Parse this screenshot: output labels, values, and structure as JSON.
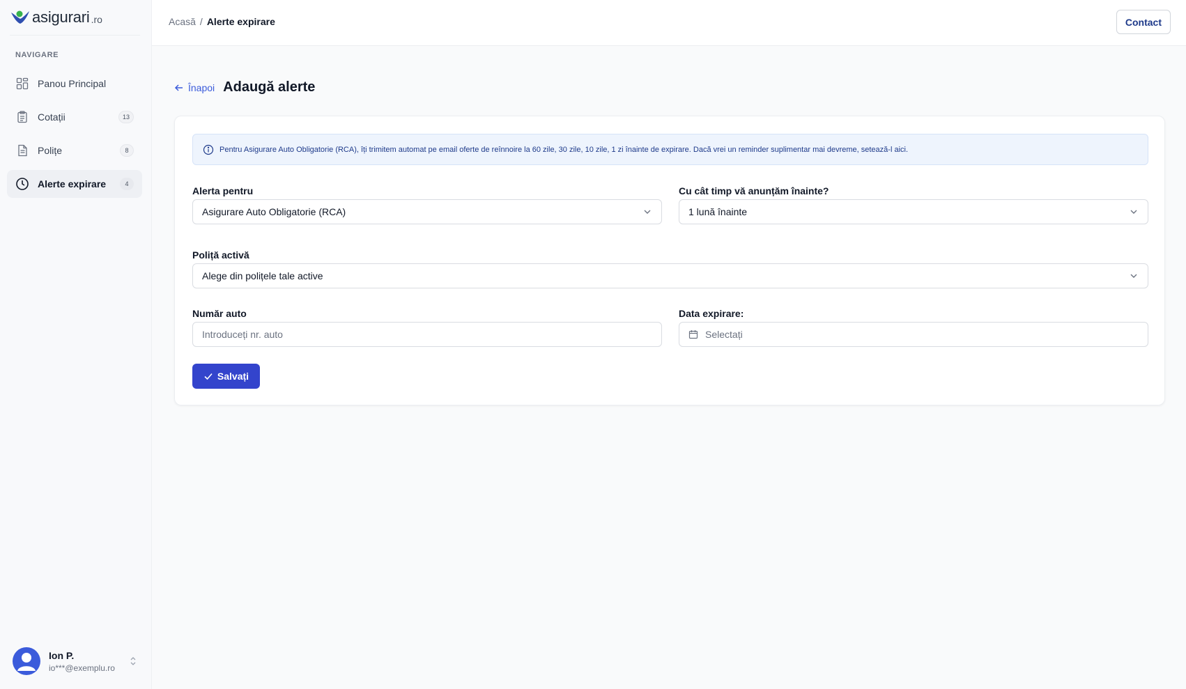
{
  "brand": {
    "name": "asigurari",
    "tld": ".ro"
  },
  "sidebar": {
    "heading": "NAVIGARE",
    "items": [
      {
        "label": "Panou Principal",
        "icon": "dashboard-icon",
        "badge": ""
      },
      {
        "label": "Cotații",
        "icon": "clipboard-icon",
        "badge": "13"
      },
      {
        "label": "Polițe",
        "icon": "document-icon",
        "badge": "8"
      },
      {
        "label": "Alerte expirare",
        "icon": "clock-icon",
        "badge": "4",
        "active": true
      }
    ],
    "user": {
      "name": "Ion P.",
      "email": "io***@exemplu.ro"
    }
  },
  "topbar": {
    "breadcrumb": {
      "home": "Acasă",
      "separator": "/",
      "current": "Alerte expirare"
    },
    "contact_label": "Contact"
  },
  "page": {
    "back_label": "Înapoi",
    "title": "Adaugă alerte"
  },
  "form": {
    "info_text": "Pentru Asigurare Auto Obligatorie (RCA), îți trimitem automat pe email oferte de reînnoire la 60 zile, 30 zile, 10 zile, 1 zi înainte de expirare. Dacă vrei un reminder suplimentar mai devreme, setează-l aici.",
    "alert_for": {
      "label": "Alerta pentru",
      "value": "Asigurare Auto Obligatorie (RCA)"
    },
    "notice": {
      "label": "Cu cât timp vă anunțăm înainte?",
      "value": "1 lună înainte"
    },
    "policy": {
      "label": "Poliță activă",
      "value": "Alege din polițele tale active"
    },
    "plate": {
      "label": "Număr auto",
      "placeholder": "Introduceți nr. auto"
    },
    "expiry": {
      "label": "Data expirare:",
      "placeholder": "Selectați"
    },
    "save_label": "Salvați"
  },
  "colors": {
    "primary": "#3344cc",
    "link": "#3b5bdb",
    "info_bg": "#eef4fd"
  }
}
